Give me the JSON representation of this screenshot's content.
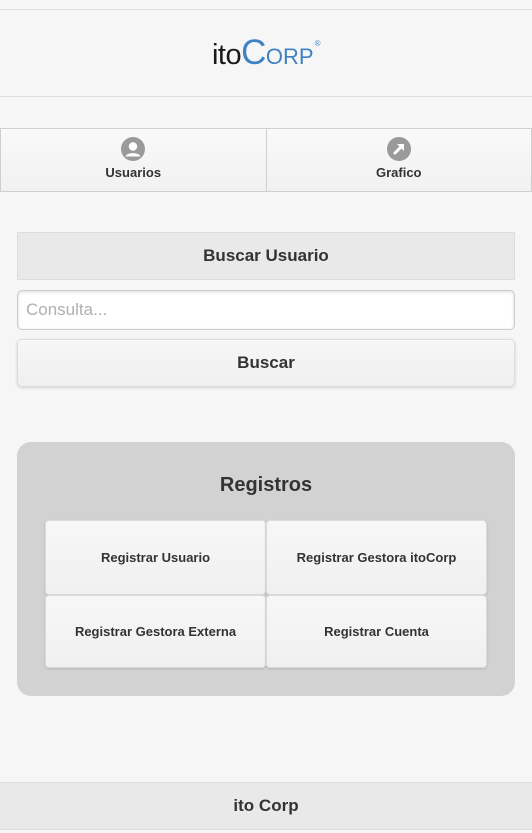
{
  "header": {
    "logo_part1": "ito",
    "logo_part2": "C",
    "logo_part3": "ORP",
    "logo_reg": "®",
    "logo_colors": {
      "dark": "#1a1a1a",
      "accent": "#3f82c4"
    }
  },
  "navbar": {
    "items": [
      {
        "label": "Usuarios",
        "icon": "user-icon"
      },
      {
        "label": "Grafico",
        "icon": "arrow-up-right-icon"
      }
    ]
  },
  "search": {
    "header": "Buscar Usuario",
    "placeholder": "Consulta...",
    "value": "",
    "button_label": "Buscar"
  },
  "registros": {
    "title": "Registros",
    "buttons": [
      {
        "label": "Registrar Usuario"
      },
      {
        "label": "Registrar Gestora itoCorp"
      },
      {
        "label": "Registrar Gestora Externa"
      },
      {
        "label": "Registrar Cuenta"
      }
    ]
  },
  "footer": {
    "text": "ito Corp"
  }
}
